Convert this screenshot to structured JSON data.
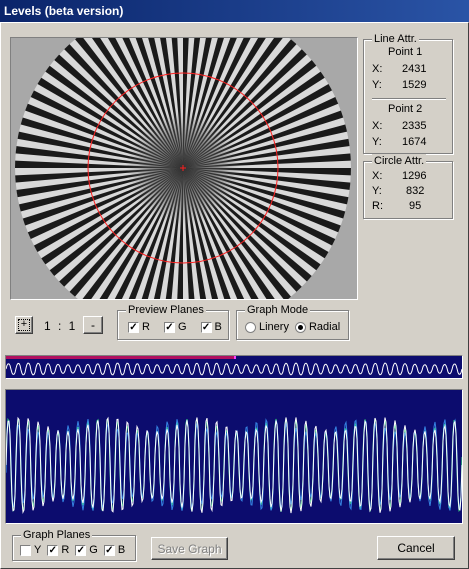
{
  "window": {
    "title": "Levels (beta version)"
  },
  "line_attr": {
    "title": "Line Attr.",
    "point1": {
      "label": "Point 1",
      "x_label": "X:",
      "x": "2431",
      "y_label": "Y:",
      "y": "1529"
    },
    "point2": {
      "label": "Point 2",
      "x_label": "X:",
      "x": "2335",
      "y_label": "Y:",
      "y": "1674"
    }
  },
  "circle_attr": {
    "title": "Circle Attr.",
    "x_label": "X:",
    "x": "1296",
    "y_label": "Y:",
    "y": "832",
    "r_label": "R:",
    "r": "95"
  },
  "zoom": {
    "plus_label": "+",
    "value": "1 : 1",
    "minus_label": "-"
  },
  "preview_planes": {
    "title": "Preview Planes",
    "items": [
      {
        "label": "R",
        "checked": true
      },
      {
        "label": "G",
        "checked": true
      },
      {
        "label": "B",
        "checked": true
      }
    ]
  },
  "graph_mode": {
    "title": "Graph Mode",
    "options": [
      {
        "label": "Linery",
        "selected": false
      },
      {
        "label": "Radial",
        "selected": true
      }
    ]
  },
  "graph_planes": {
    "title": "Graph Planes",
    "items": [
      {
        "label": "Y",
        "checked": false
      },
      {
        "label": "R",
        "checked": true
      },
      {
        "label": "G",
        "checked": true
      },
      {
        "label": "B",
        "checked": true
      }
    ]
  },
  "buttons": {
    "save_graph": "Save Graph",
    "cancel": "Cancel"
  },
  "colors": {
    "titlebar": "#0a246a",
    "graph_bg": "#0c0c6e",
    "waveform": "#ffffff",
    "circle": "#ff2020"
  },
  "graph": {
    "cycles": 46
  }
}
